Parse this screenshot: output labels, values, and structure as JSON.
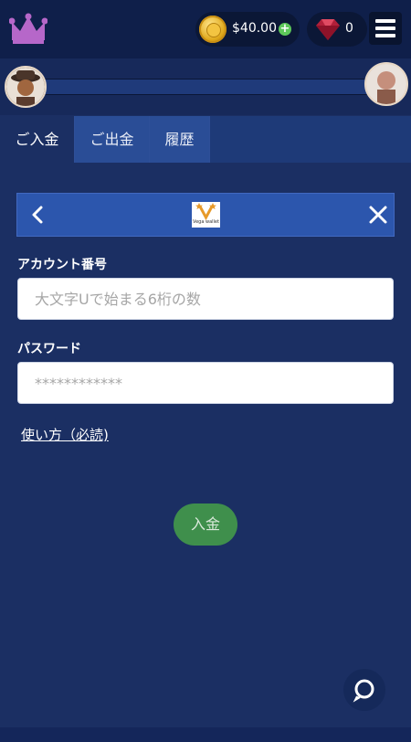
{
  "header": {
    "balance": "$40.00",
    "gem_count": "0"
  },
  "tabs": [
    {
      "label": "ご入金"
    },
    {
      "label": "ご出金"
    },
    {
      "label": "履歴"
    }
  ],
  "panel": {
    "logo_text": "Vega wallet"
  },
  "form": {
    "account_label": "アカウント番号",
    "account_placeholder": "大文字Uで始まる6桁の数",
    "password_label": "パスワード",
    "password_placeholder": "************",
    "howto_link": "使い方（必読)",
    "submit_label": "入金"
  },
  "colors": {
    "background": "#1b2f63",
    "header": "#0f1f4a",
    "panel_header": "#2c56ad",
    "submit_button": "#3f8f4c",
    "plus_button": "#5dc85a"
  }
}
